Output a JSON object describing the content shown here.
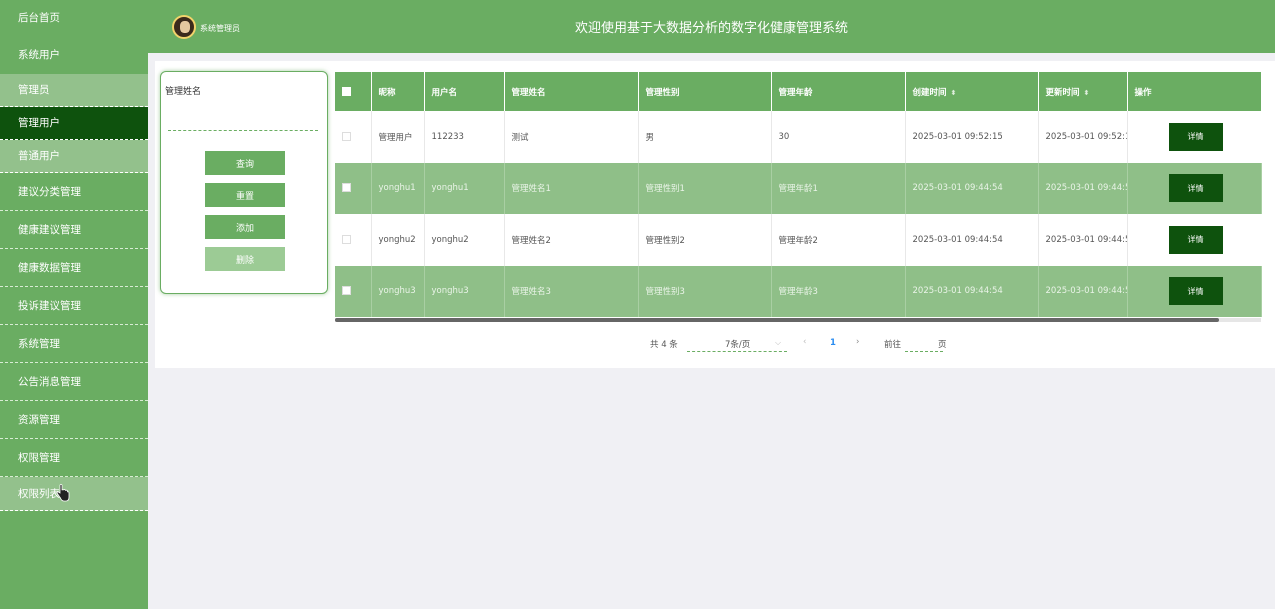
{
  "sidebar": {
    "items": [
      {
        "label": "后台首页"
      },
      {
        "label": "系统用户"
      },
      {
        "label": "管理员"
      },
      {
        "label": "管理用户"
      },
      {
        "label": "普通用户"
      },
      {
        "label": "建议分类管理"
      },
      {
        "label": "健康建议管理"
      },
      {
        "label": "健康数据管理"
      },
      {
        "label": "投诉建议管理"
      },
      {
        "label": "系统管理"
      },
      {
        "label": "公告消息管理"
      },
      {
        "label": "资源管理"
      },
      {
        "label": "权限管理"
      },
      {
        "label": "权限列表"
      }
    ],
    "active": "管理用户"
  },
  "header": {
    "role": "系统管理员",
    "title": "欢迎使用基于大数据分析的数字化健康管理系统"
  },
  "search": {
    "label": "管理姓名",
    "value": "",
    "buttons": {
      "query": "查询",
      "reset": "重置",
      "add": "添加",
      "delete": "删除"
    }
  },
  "table": {
    "columns": [
      "昵称",
      "用户名",
      "管理姓名",
      "管理性别",
      "管理年龄",
      "创建时间",
      "更新时间",
      "操作"
    ],
    "rows": [
      [
        "管理用户",
        "112233",
        "测试",
        "男",
        "30",
        "2025-03-01 09:52:15",
        "2025-03-01 09:52:1",
        "详情"
      ],
      [
        "yonghu1",
        "yonghu1",
        "管理姓名1",
        "管理性别1",
        "管理年龄1",
        "2025-03-01 09:44:54",
        "2025-03-01 09:44:5",
        "详情"
      ],
      [
        "yonghu2",
        "yonghu2",
        "管理姓名2",
        "管理性别2",
        "管理年龄2",
        "2025-03-01 09:44:54",
        "2025-03-01 09:44:5",
        "详情"
      ],
      [
        "yonghu3",
        "yonghu3",
        "管理姓名3",
        "管理性别3",
        "管理年龄3",
        "2025-03-01 09:44:54",
        "2025-03-01 09:44:5",
        "详情"
      ]
    ]
  },
  "pagination": {
    "total": "共 4 条",
    "page_size": "7条/页",
    "current": "1",
    "goto_label": "前往",
    "goto_unit": "页",
    "prev_icon": "chevron-left-icon",
    "next_icon": "chevron-right-icon"
  },
  "colors": {
    "primary": "#6aad62",
    "active": "#0e520d",
    "row_alt": "#8fbf88"
  }
}
